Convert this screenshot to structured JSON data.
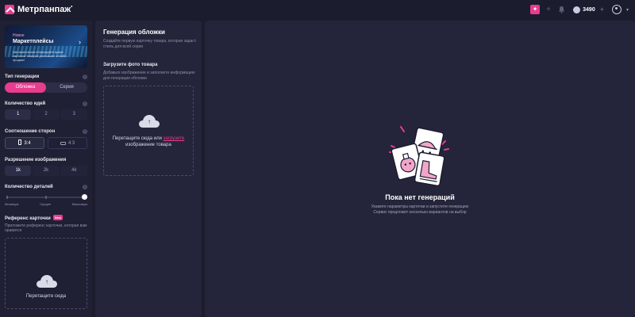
{
  "header": {
    "logo_text": "Метрпанпаж",
    "balance": "3490",
    "plus": "+"
  },
  "promo": {
    "tag": "Новое",
    "title": "Маркетплейсы",
    "desc": "Автоматически генерируйте яркие карточки товаров для ваших онлайн-продаж!"
  },
  "sidebar": {
    "gen_type_label": "Тип генерации",
    "gen_types": [
      "Обложка",
      "Серия"
    ],
    "ideas_label": "Количество идей",
    "ideas": [
      "1",
      "2",
      "3"
    ],
    "ratio_label": "Соотношение сторон",
    "ratios": [
      "3:4",
      "4:3"
    ],
    "resolution_label": "Разрешение изображения",
    "resolutions": [
      "1k",
      "2k",
      "4k"
    ],
    "detail_label": "Количество деталей",
    "detail_levels": [
      "Минимум",
      "Средне",
      "Максимум"
    ],
    "detail_value": 1.0,
    "reference_label": "Референс карточки",
    "reference_badge": "New",
    "reference_desc": "Приложите референс карточки, которая вам нравится",
    "reference_drop": "Перетащите сюда"
  },
  "middle": {
    "title": "Генерация обложки",
    "desc": "Создайте первую карточку товара, которая задаст стиль для всей серии",
    "upload_label": "Загрузите фото товара",
    "upload_desc": "Добавьте изображение и заполните информацию для генерации обложки",
    "drop_text_1": "Перетащите сюда или ",
    "drop_link": "загрузите",
    "drop_text_2": "изображение товара"
  },
  "right": {
    "empty_title": "Пока нет генераций",
    "empty_desc_1": "Укажите параметры карточки и запустите генерацию",
    "empty_desc_2": "Сервис предложит несколько вариантов на выбор"
  },
  "colors": {
    "accent": "#e83c8f",
    "bg": "#1b1c2e",
    "panel": "#24253a"
  },
  "icons": [
    "logo-icon",
    "gift-icon",
    "magic-icon",
    "bell-icon",
    "coin-icon",
    "avatar-icon",
    "info-icon",
    "upload-cloud-icon",
    "empty-illustration-icon"
  ]
}
